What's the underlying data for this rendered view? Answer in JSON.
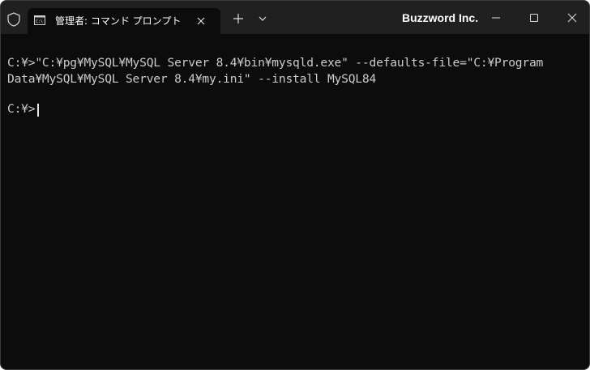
{
  "tab": {
    "title": "管理者: コマンド プロンプト",
    "icon": "terminal-icon"
  },
  "titlebar": {
    "app_title": "Buzzword Inc.",
    "icons": [
      "shield-icon",
      "plus-icon",
      "chevron-down-icon",
      "minimize-icon",
      "maximize-icon",
      "close-icon"
    ]
  },
  "console": {
    "lines": [
      "C:¥>\"C:¥pg¥MySQL¥MySQL Server 8.4¥bin¥mysqld.exe\" --defaults-file=\"C:¥Program",
      "Data¥MySQL¥MySQL Server 8.4¥my.ini\" --install MySQL84",
      "C:¥>"
    ]
  },
  "colors": {
    "titlebar_bg": "#202020",
    "console_bg": "#0c0c0c",
    "console_text": "#cccccc"
  }
}
